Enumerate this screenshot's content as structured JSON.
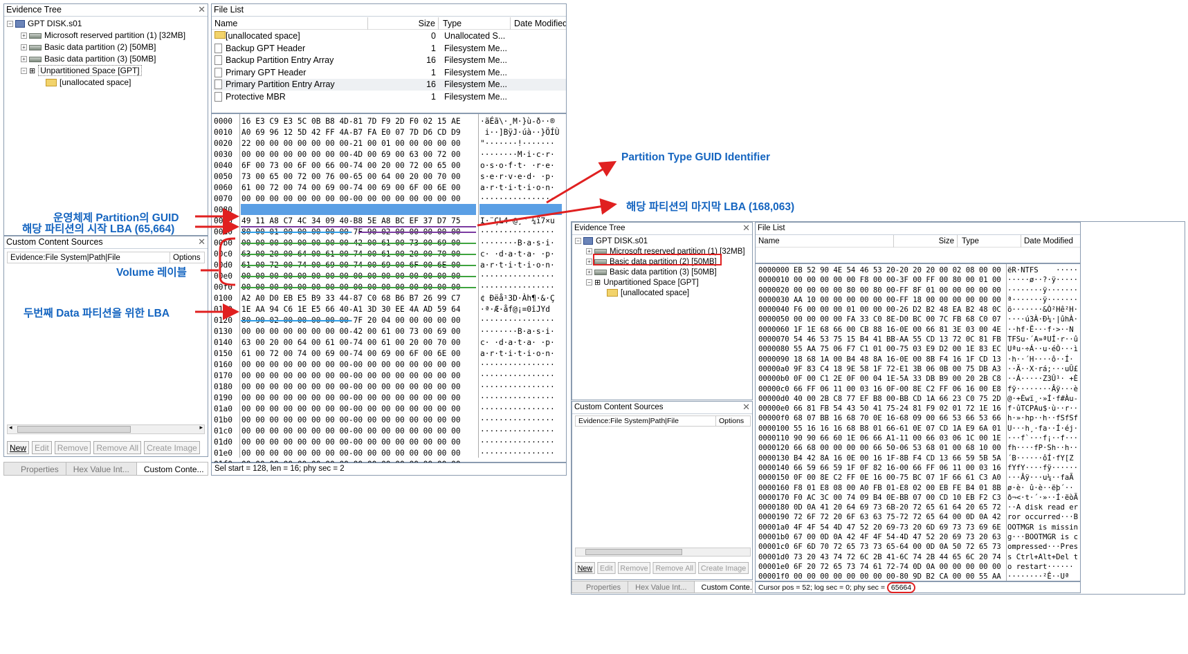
{
  "left": {
    "evidence_tree": {
      "title": "Evidence Tree",
      "root": "GPT DISK.s01",
      "items": [
        "Microsoft reserved partition (1) [32MB]",
        "Basic data partition (2) [50MB]",
        "Basic data partition (3) [50MB]",
        "Unpartitioned Space [GPT]",
        "[unallocated space]"
      ]
    },
    "ccs": {
      "title": "Custom Content Sources",
      "col1": "Evidence:File System|Path|File",
      "col2": "Options"
    },
    "buttons": [
      "New",
      "Edit",
      "Remove",
      "Remove All",
      "Create Image"
    ],
    "tabs": [
      "Properties",
      "Hex Value Int...",
      "Custom Conte..."
    ],
    "file_list": {
      "title": "File List",
      "columns": [
        "Name",
        "Size",
        "Type",
        "Date Modified"
      ],
      "rows": [
        {
          "name": "[unallocated space]",
          "size": "0",
          "type": "Unallocated S..."
        },
        {
          "name": "Backup GPT Header",
          "size": "1",
          "type": "Filesystem Me..."
        },
        {
          "name": "Backup Partition Entry Array",
          "size": "16",
          "type": "Filesystem Me..."
        },
        {
          "name": "Primary GPT Header",
          "size": "1",
          "type": "Filesystem Me..."
        },
        {
          "name": "Primary Partition Entry Array",
          "size": "16",
          "type": "Filesystem Me..."
        },
        {
          "name": "Protective MBR",
          "size": "1",
          "type": "Filesystem Me..."
        }
      ]
    },
    "hex_offsets": [
      "0000",
      "0010",
      "0020",
      "0030",
      "0040",
      "0050",
      "0060",
      "0070",
      "0080",
      "0090",
      "00a0",
      "00b0",
      "00c0",
      "00d0",
      "00e0",
      "00f0",
      "0100",
      "0110",
      "0120",
      "0130",
      "0140",
      "0150",
      "0160",
      "0170",
      "0180",
      "0190",
      "01a0",
      "01b0",
      "01c0",
      "01d0",
      "01e0",
      "01f0"
    ],
    "hex_bytes": [
      "16 E3 C9 E3 5C 0B B8 4D-81 7D F9 2D F0 02 15 AE",
      "A0 69 96 12 5D 42 FF 4A-B7 FA E0 07 7D D6 CD D9",
      "22 00 00 00 00 00 00 00-21 00 01 00 00 00 00 00",
      "00 00 00 00 00 00 00 00-4D 00 69 00 63 00 72 00",
      "6F 00 73 00 6F 00 66 00-74 00 20 00 72 00 65 00",
      "73 00 65 00 72 00 76 00-65 00 64 00 20 00 70 00",
      "61 00 72 00 74 00 69 00-74 00 69 00 6F 00 6E 00",
      "00 00 00 00 00 00 00 00-00 00 00 00 00 00 00 00",
      "A2 A0 D0 EB E5 B9 33 44-87 C0 68 B6 B7 26 99 C7",
      "49 11 A8 C7 4C 34 09 40-B8 5E A8 BC EF 37 D7 75",
      "80 00 01 00 00 00 00 00-7F 90 02 00 00 00 00 00",
      "00 00 00 00 00 00 00 00-42 00 61 00 73 00 69 00",
      "63 00 20 00 64 00 61 00-74 00 61 00 20 00 70 00",
      "61 00 72 00 74 00 69 00-74 00 69 00 6F 00 6E 00",
      "00 00 00 00 00 00 00 00-00 00 00 00 00 00 00 00",
      "00 00 00 00 00 00 00 00-00 00 00 00 00 00 00 00",
      "A2 A0 D0 EB E5 B9 33 44-87 C0 68 B6 B7 26 99 C7",
      "1E AA 94 C6 1E E5 66 40-A1 3D 30 EE 4A AD 59 64",
      "80 90 02 00 00 00 00 00-7F 20 04 00 00 00 00 00",
      "00 00 00 00 00 00 00 00-42 00 61 00 73 00 69 00",
      "63 00 20 00 64 00 61 00-74 00 61 00 20 00 70 00",
      "61 00 72 00 74 00 69 00-74 00 69 00 6F 00 6E 00",
      "00 00 00 00 00 00 00 00-00 00 00 00 00 00 00 00",
      "00 00 00 00 00 00 00 00-00 00 00 00 00 00 00 00",
      "00 00 00 00 00 00 00 00-00 00 00 00 00 00 00 00",
      "00 00 00 00 00 00 00 00-00 00 00 00 00 00 00 00",
      "00 00 00 00 00 00 00 00-00 00 00 00 00 00 00 00",
      "00 00 00 00 00 00 00 00-00 00 00 00 00 00 00 00",
      "00 00 00 00 00 00 00 00-00 00 00 00 00 00 00 00",
      "00 00 00 00 00 00 00 00-00 00 00 00 00 00 00 00",
      "00 00 00 00 00 00 00 00-00 00 00 00 00 00 00 00",
      "00 00 00 00 00 00 00 00-00 00 00 00 00 00 00 00"
    ],
    "hex_ascii": [
      "·ãÉã\\·¸M·}ù-ð··®",
      " i··]BÿJ·úà··}ÖÍÙ",
      "\"·······!·······",
      "········M·i·c·r·",
      "o·s·o·f·t· ·r·e·",
      "s·e·r·v·e·d· ·p·",
      "a·r·t·i·t·i·o·n·",
      "················",
      "¢ Ðëå¹3D·Àh¶·&·Ç",
      "I·¨ÇL4·@¸^¨¼ï7×u",
      "················",
      "········B·a·s·i·",
      "c· ·d·a·t·a· ·p·",
      "a·r·t·i·t·i·o·n·",
      "················",
      "················",
      "¢ Ðëå¹3D·Àh¶·&·Ç",
      "·ª·Æ·åf@¡=0îJ­Yd",
      "················",
      "········B·a·s·i·",
      "c· ·d·a·t·a· ·p·",
      "a·r·t·i·t·i·o·n·",
      "················",
      "················",
      "················",
      "················",
      "················",
      "················",
      "················",
      "················",
      "················",
      "················"
    ],
    "status": "Sel start = 128, len = 16; phy sec = 2"
  },
  "right": {
    "evidence_tree": {
      "title": "Evidence Tree",
      "root": "GPT DISK.s01",
      "items": [
        "Microsoft reserved partition (1) [32MB]",
        "Basic data partition (2) [50MB]",
        "Basic data partition (3) [50MB]",
        "Unpartitioned Space [GPT]",
        "[unallocated space]"
      ]
    },
    "ccs": {
      "title": "Custom Content Sources",
      "col1": "Evidence:File System|Path|File",
      "col2": "Options"
    },
    "buttons": [
      "New",
      "Edit",
      "Remove",
      "Remove All",
      "Create Image"
    ],
    "tabs": [
      "Properties",
      "Hex Value Int...",
      "Custom Conte..."
    ],
    "file_list": {
      "title": "File List",
      "columns": [
        "Name",
        "Size",
        "Type",
        "Date Modified"
      ]
    },
    "hex_lines": [
      "0000000 EB 52 90 4E 54 46 53 20-20 20 20 00 02 08 00 00",
      "0000010 00 00 00 00 00 F8 00 00-3F 00 FF 00 80 00 01 00",
      "0000020 00 00 00 00 80 00 80 00-FF 8F 01 00 00 00 00 00",
      "0000030 AA 10 00 00 00 00 00 00-FF 18 00 00 00 00 00 00",
      "0000040 F6 00 00 00 01 00 00 00-26 D2 B2 48 EA B2 48 0C",
      "0000050 00 00 00 00 FA 33 C0 8E-D0 BC 00 7C FB 68 C0 07",
      "0000060 1F 1E 68 66 00 CB 88 16-0E 00 66 81 3E 03 00 4E",
      "0000070 54 46 53 75 15 B4 41 BB-AA 55 CD 13 72 0C 81 FB",
      "0000080 55 AA 75 06 F7 C1 01 00-75 03 E9 D2 00 1E 83 EC",
      "0000090 18 68 1A 00 B4 48 8A 16-0E 00 8B F4 16 1F CD 13",
      "00000a0 9F 83 C4 18 9E 58 1F 72-E1 3B 06 0B 00 75 DB A3",
      "00000b0 0F 00 C1 2E 0F 00 04 1E-5A 33 DB B9 00 20 2B C8",
      "00000c0 66 FF 06 11 00 03 16 0F-00 8E C2 FF 06 16 00 E8",
      "00000d0 40 00 2B C8 77 EF B8 00-BB CD 1A 66 23 C0 75 2D",
      "00000e0 66 81 FB 54 43 50 41 75-24 81 F9 02 01 72 1E 16",
      "00000f0 68 07 BB 16 68 70 0E 16-68 09 00 66 53 66 53 66",
      "0000100 55 16 16 16 68 B8 01 66-61 0E 07 CD 1A E9 6A 01",
      "0000110 90 90 66 60 1E 06 66 A1-11 00 66 03 06 1C 00 1E",
      "0000120 66 68 00 00 00 00 66 50-06 53 68 01 00 68 10 00",
      "0000130 B4 42 8A 16 0E 00 16 1F-8B F4 CD 13 66 59 5B 5A",
      "0000140 66 59 66 59 1F 0F 82 16-00 66 FF 06 11 00 03 16",
      "0000150 0F 00 8E C2 FF 0E 16 00-75 BC 07 1F 66 61 C3 A0",
      "0000160 F8 01 E8 08 00 A0 FB 01-E8 02 00 EB FE B4 01 8B",
      "0000170 F0 AC 3C 00 74 09 B4 0E-BB 07 00 CD 10 EB F2 C3",
      "0000180 0D 0A 41 20 64 69 73 6B-20 72 65 61 64 20 65 72",
      "0000190 72 6F 72 20 6F 63 63 75-72 72 65 64 00 0D 0A 42",
      "00001a0 4F 4F 54 4D 47 52 20 69-73 20 6D 69 73 73 69 6E",
      "00001b0 67 00 0D 0A 42 4F 4F 54-4D 47 52 20 69 73 20 63",
      "00001c0 6F 6D 70 72 65 73 73 65-64 00 0D 0A 50 72 65 73",
      "00001d0 73 20 43 74 72 6C 2B 41-6C 74 2B 44 65 6C 20 74",
      "00001e0 6F 20 72 65 73 74 61 72-74 0D 0A 00 00 00 00 00",
      "00001f0 00 00 00 00 00 00 00 00-80 9D B2 CA 00 00 55 AA",
      "0000200 07 00 42 00 4F 00 4F 00-54 00 4D 00 47 00 52 00"
    ],
    "hex_ascii": [
      "ëR·NTFS    ·····",
      "·····ø··?·ÿ·····",
      "········ÿ·······",
      "ª·······ÿ·······",
      "ö·······&Ò²Hê²H·",
      "····ú3À·Ð¼·|ûhÀ·",
      "··hf·Ë···f·>··N",
      "TFSu·´A»ªUÍ·r··û",
      "Uªu·÷Á··u·éÒ···ì",
      "·h··´H····ô··Í·",
      "··Ä··X·rá;···uÛ£",
      "··Á·····Z3Û¹· +È",
      "fÿ········Âÿ···è",
      "@·+Èwï¸·»Í·f#Àu-",
      "f·ûTCPAu$·ù··r··",
      "h·»·hp··h··fSfSf",
      "U···h¸·fa··Í·éj·",
      "···f`···f¡··f···",
      "fh····fP·Sh··h··",
      "´B······ôÍ·fY[Z",
      "fYfY····fÿ······",
      "···Âÿ···u¼··faÃ ",
      "ø·è· û·è··ëþ´··",
      "ð¬<·t·´·»··Í·ëòÃ",
      "··A disk read er",
      "ror occurred···B",
      "OOTMGR is missin",
      "g···BOOTMGR is c",
      "ompressed···Pres",
      "s Ctrl+Alt+Del t",
      "o restart······",
      "········²Ê··Uª",
      "··B·O·O·T·M·G·R·"
    ],
    "status_prefix": "Cursor pos = 52; log sec = 0; phy sec = ",
    "status_sec": "65664"
  },
  "annotations": {
    "partition_type_guid": "Partition Type GUID Identifier",
    "last_lba": "해당 파티션의 마지막 LBA (168,063)",
    "os_guid": "운영체제 Partition의 GUID",
    "start_lba": "해당 파티션의 시작 LBA (65,664)",
    "volume_label": "Volume 레이블",
    "second_lba": "두번째 Data 파티션을 위한 LBA"
  },
  "colors": {
    "annotation_text": "#1565c0",
    "arrow": "#e02020",
    "selection": "#3d8ee0",
    "green_underline": "#3da33d",
    "purple_underline": "#7a3aa0",
    "blue_underline": "#2e9ee8"
  }
}
